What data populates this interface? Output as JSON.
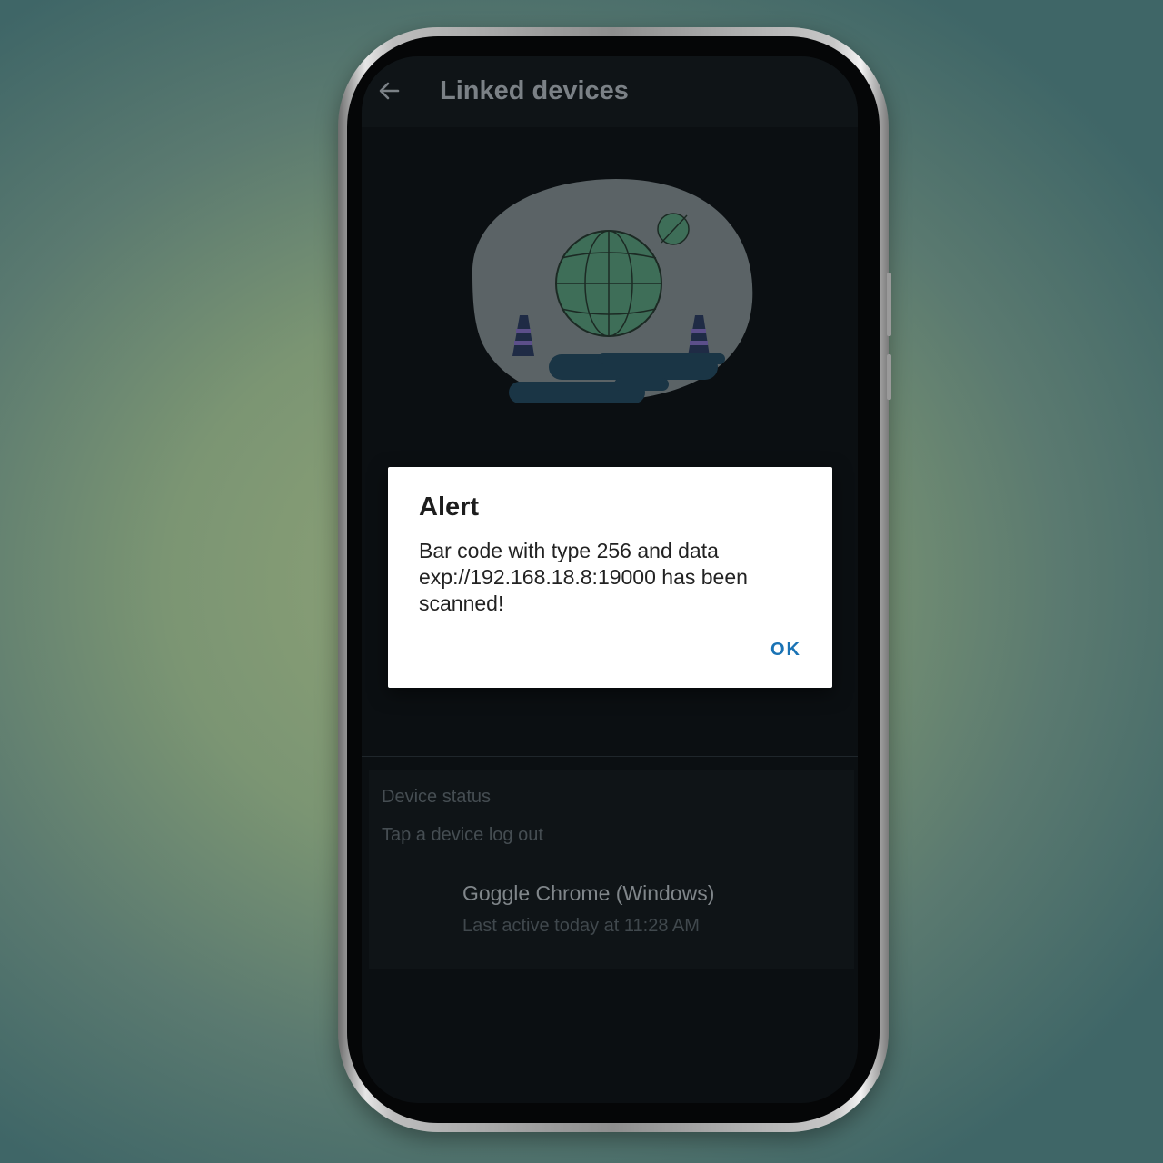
{
  "app_bar": {
    "title": "Linked devices",
    "back_icon": "arrow-left-icon"
  },
  "illustration": {
    "description_icon": "globe-with-traffic-cones-illustration"
  },
  "device_section": {
    "header": "Device status",
    "hint": "Tap a device log out",
    "devices": [
      {
        "name": "Goggle Chrome (Windows)",
        "last_active": "Last active today at 11:28 AM"
      }
    ]
  },
  "dialog": {
    "title": "Alert",
    "message": "Bar code with type 256 and data exp://192.168.18.8:19000 has been scanned!",
    "ok_label": "OK"
  },
  "colors": {
    "screen_bg": "#0b0f12",
    "dialog_bg": "#ffffff",
    "accent": "#1a73b5"
  }
}
